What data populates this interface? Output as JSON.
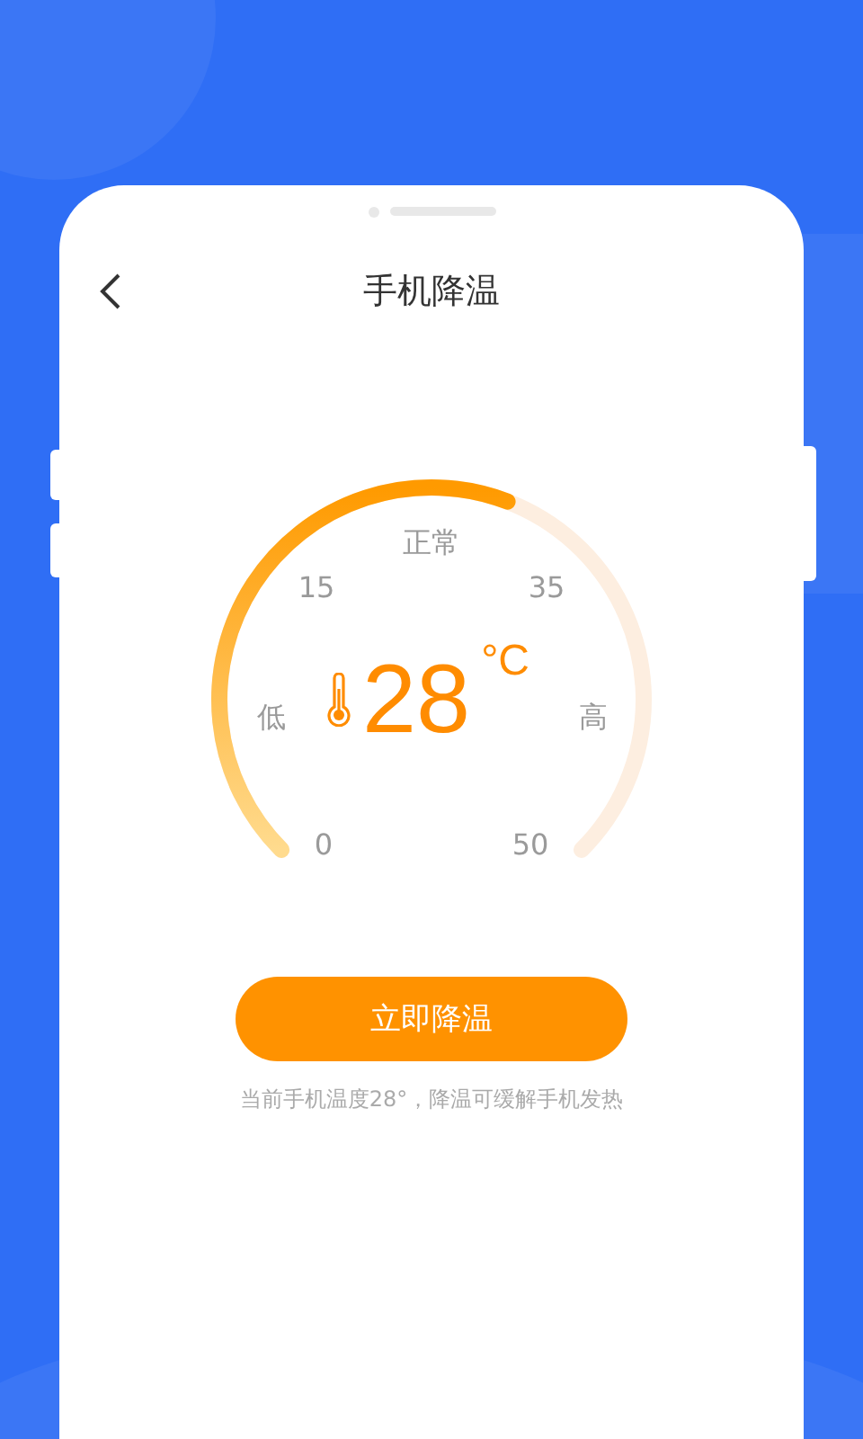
{
  "screen": {
    "title": "手机降温"
  },
  "gauge": {
    "status": "正常",
    "low_label": "低",
    "high_label": "高",
    "ticks": [
      "15",
      "35",
      "0",
      "50"
    ],
    "value": "28",
    "unit": "°C"
  },
  "action_button": {
    "label": "立即降温"
  },
  "hint": "当前手机温度28°，降温可缓解手机发热"
}
